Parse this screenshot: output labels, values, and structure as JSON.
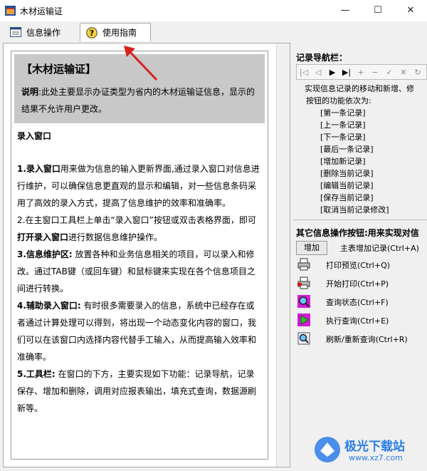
{
  "window": {
    "title": "木材运输证",
    "minimize": "—",
    "maximize": "☐",
    "close": "✕"
  },
  "tabs": [
    {
      "label": "信息操作"
    },
    {
      "label": "使用指南"
    }
  ],
  "guide": {
    "title": "【木材运输证】",
    "note_label": "说明",
    "note": ":此处主要显示办证类型为省内的木材运输证信息，显示的结果不允许用户更改。",
    "section": "录入窗口",
    "p1_bold": "1.录入窗口",
    "p1": "用来做为信息的输入更新界面,通过录入窗口对信息进行维护，可以确保信息更直观的显示和编辑，对一些信息条码采用了高效的录入方式，提高了信息维护的效率和准确率。",
    "p2a": "2.在主窗口工具栏上单击“录入窗口”按钮或双击表格界面，即可",
    "p2_bold": "打开录入窗口",
    "p2b": "进行数据信息维护操作。",
    "p3_bold": "3.信息维护区:",
    "p3": " 放置各种和业务信息相关的项目，可以录入和修改。通过TAB键（或回车键）和鼠标键来实现在各个信息项目之间进行转换。",
    "p4_bold": "4.辅助录入窗口:",
    "p4": " 有时很多需要录入的信息，系统中已经存在或者通过计算处理可以得到，将出现一个动态变化内容的窗口，我们可以在该窗口内选择内容代替手工输入，从而提高输入效率和准确率。",
    "p5_bold": "5.工具栏:",
    "p5": " 在窗口的下方，主要实现如下功能：记录导航，记录保存、增加和删除，调用对应报表输出，填充式查询，数据源刷新等。"
  },
  "nav": {
    "heading": "记录导航栏：",
    "buttons": [
      "|◁",
      "◁",
      "▶",
      "▶|",
      "+",
      "−",
      "✓",
      "✕",
      "↻"
    ],
    "desc1": "实现信息记录的移动和新增、修",
    "desc2": "按钮的功能依次为:",
    "items": [
      "[第一条记录]",
      "[上一条记录]",
      "[下一条记录]",
      "[最后一条记录]",
      "[增加新记录]",
      "[删除当前记录]",
      "[编辑当前记录]",
      "[保存当前记录]",
      "[取消当前记录修改]"
    ]
  },
  "other": {
    "heading": "其它信息操作按钮:用来实现对信",
    "add_button": "增加",
    "add_desc": "主表增加记录(Ctrl+A)",
    "ops": [
      {
        "icon": "printer-icon",
        "label": "打印预览(Ctrl+Q)"
      },
      {
        "icon": "print-start-icon",
        "label": "开始打印(Ctrl+P)"
      },
      {
        "icon": "query-state-icon",
        "label": "查询状态(Ctrl+F)"
      },
      {
        "icon": "run-query-icon",
        "label": "执行查询(Ctrl+E)"
      },
      {
        "icon": "refresh-query-icon",
        "label": "刷新/重新查询(Ctrl+R)"
      }
    ]
  },
  "watermark": {
    "text": "极光下载站",
    "url": "www.xz7.com"
  }
}
